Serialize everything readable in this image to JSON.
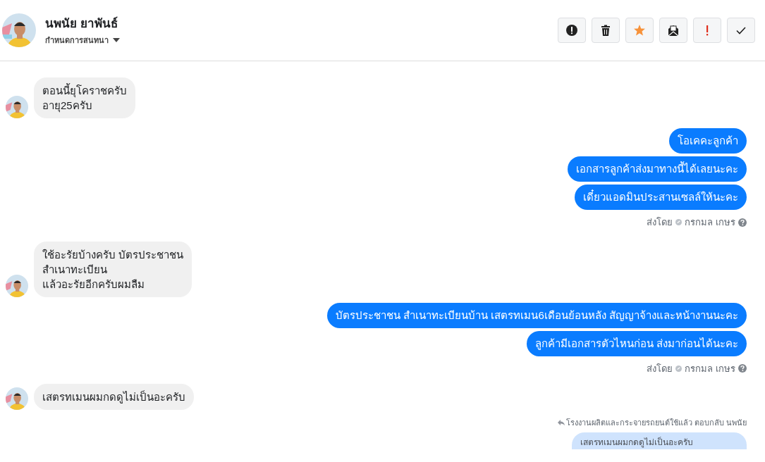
{
  "header": {
    "name": "นพนัย ยาพันธ์",
    "subtitle": "กำหนดการสนทนา",
    "actions": [
      {
        "kind": "alert"
      },
      {
        "kind": "trash"
      },
      {
        "kind": "star"
      },
      {
        "kind": "mail"
      },
      {
        "kind": "important"
      },
      {
        "kind": "done"
      }
    ]
  },
  "messages": [
    {
      "kind": "incoming",
      "bubbles": [
        [
          "ตอนนี้ยุโคราชครับ",
          "อายุ25ครับ"
        ]
      ]
    },
    {
      "kind": "outgoing",
      "bubbles": [
        [
          "โอเคคะลูกค้า"
        ],
        [
          "เอกสารลูกค้าส่งมาทางนี้ได้เลยนะคะ"
        ],
        [
          "เดี๋ยวแอดมินประสานเซลล์ให้นะคะ"
        ]
      ],
      "sent_label": "ส่งโดย",
      "sender": "กรกมล เกษร"
    },
    {
      "kind": "incoming",
      "bubbles": [
        [
          "ใช้อะรัยบ้างครับ บัตรประชาชน",
          "สำเนาทะเบียน",
          "แล้วอะรัยอีกครับผมลืม"
        ]
      ]
    },
    {
      "kind": "outgoing",
      "bubbles": [
        [
          "บัตรประชาชน สำเนาทะเบียนบ้าน เสตรทเมน6เดือนย้อนหลัง สัญญาจ้างและหน้างานนะคะ"
        ],
        [
          "ลูกค้ามีเอกสารตัวไหนก่อน ส่งมาก่อนได้นะคะ"
        ]
      ],
      "sent_label": "ส่งโดย",
      "sender": "กรกมล เกษร"
    },
    {
      "kind": "incoming",
      "bubbles": [
        [
          "เสตรทเมนผมกดดูไม่เป็นอะครับ"
        ]
      ]
    },
    {
      "kind": "reply",
      "note": "โรงงานผลิตและกระจายรถยนต์ใช้แล้ว ตอบกลับ นพนัย",
      "quote": "เสตรทเมนผมกดดูไม่เป็นอะครับ"
    }
  ]
}
